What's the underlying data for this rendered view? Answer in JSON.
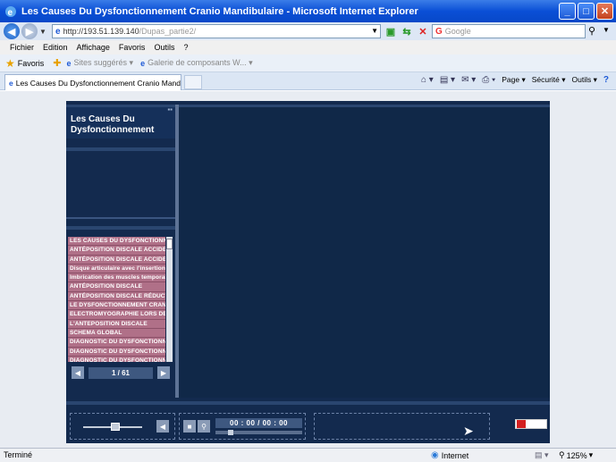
{
  "window": {
    "title": "Les Causes Du Dysfonctionnement Cranio Mandibulaire - Microsoft Internet Explorer",
    "buttons": {
      "minimize": "_",
      "maximize": "□",
      "close": "✕"
    }
  },
  "address_bar": {
    "url_host": "http://193.51.139.140",
    "url_path": "/Dupas_partie2/",
    "search_placeholder": "Google"
  },
  "menu": [
    "Fichier",
    "Edition",
    "Affichage",
    "Favoris",
    "Outils",
    "?"
  ],
  "favorites_bar": {
    "favorites_label": "Favoris",
    "suggested_sites": "Sites suggérés ▾",
    "web_slice": "Galerie de composants W... ▾"
  },
  "tab": {
    "title": "Les Causes Du Dysfonctionnement Cranio Mandibulaire"
  },
  "command_bar": {
    "page": "Page ▾",
    "security": "Sécurité ▾",
    "tools": "Outils ▾",
    "help": "?"
  },
  "player": {
    "title": "Les Causes Du Dysfonctionnement",
    "slides": [
      "LES CAUSES DU DYSFONCTIONNEMENT",
      "ANTÉPOSITION DISCALE ACCIDENTELLE",
      "ANTÉPOSITION DISCALE ACCIDENTELLE",
      "Disque articulaire avec l'insertion du chef",
      "Imbrication des muscles temporal, masséter",
      "ANTÉPOSITION DISCALE",
      "ANTÉPOSITION DISCALE RÉDUCTIBLE",
      "LE DYSFONCTIONNEMENT CRANIO",
      "ELECTROMYOGRAPHIE LORS DES",
      "L'ANTEPOSITION DISCALE",
      "SCHEMA GLOBAL",
      "DIAGNOSTIC DU DYSFONCTIONNEMENT",
      "DIAGNOSTIC DU DYSFONCTIONNEMENT",
      "DIAGNOSTIC DU DYSFONCTIONNEMENT"
    ],
    "page_counter": "1 / 61",
    "time": "00 : 00 / 00 : 00",
    "progress": 0.15,
    "volume": 0.55
  },
  "status_bar": {
    "text": "Terminé",
    "zone": "Internet",
    "zoom": "125%"
  }
}
